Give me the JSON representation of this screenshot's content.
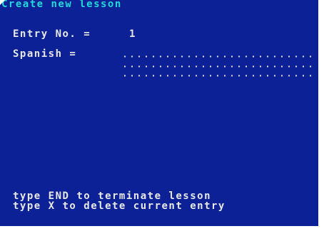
{
  "screen": {
    "title": "Create new lesson",
    "entry_label": "Entry No. =",
    "entry_value": "1",
    "field_label": "Spanish =",
    "help_line_1": "type END to terminate lesson",
    "help_line_2": "type X to delete current entry"
  },
  "colors": {
    "background": "#0c2196",
    "title": "#22d8d8",
    "text": "#e8e8e8"
  }
}
